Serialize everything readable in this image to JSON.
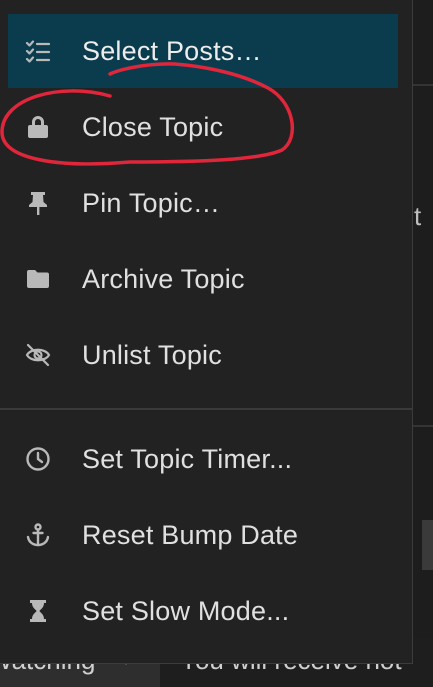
{
  "menu": {
    "items": [
      {
        "label": "Select Posts…",
        "icon": "checklist-icon"
      },
      {
        "label": "Close Topic",
        "icon": "lock-icon"
      },
      {
        "label": "Pin Topic…",
        "icon": "thumbtack-icon"
      },
      {
        "label": "Archive Topic",
        "icon": "folder-icon"
      },
      {
        "label": "Unlist Topic",
        "icon": "eye-slash-icon"
      },
      {
        "label": "Set Topic Timer...",
        "icon": "clock-icon"
      },
      {
        "label": "Reset Bump Date",
        "icon": "anchor-icon"
      },
      {
        "label": "Set Slow Mode...",
        "icon": "hourglass-icon"
      }
    ]
  },
  "background": {
    "peek_letter": "t",
    "notification_button": "Watching",
    "notification_text": "You will receive not"
  },
  "colors": {
    "menu_bg": "#222222",
    "active_bg": "#0b3c4d",
    "annotation": "#e0263a"
  }
}
